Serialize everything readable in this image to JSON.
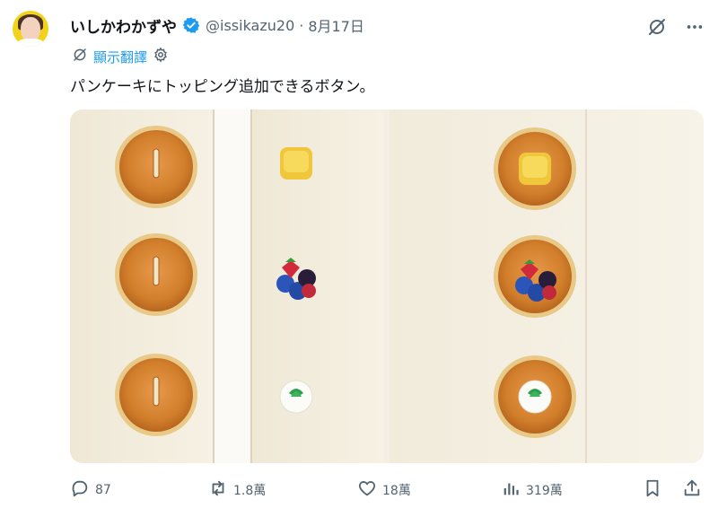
{
  "tweet": {
    "author_name": "いしかわかずや",
    "handle": "@issikazu20",
    "separator": "·",
    "date": "8月17日",
    "translate_label": "顯示翻譯",
    "text": "パンケーキにトッピング追加できるボタン。"
  },
  "actions": {
    "replies": "87",
    "retweets": "1.8萬",
    "likes": "18萬",
    "views": "319萬"
  },
  "colors": {
    "accent": "#1d9bf0",
    "secondary_text": "#536471",
    "avatar_bg": "#f2d21a"
  },
  "icons": [
    "verified-badge-icon",
    "grok-icon",
    "more-icon",
    "translate-globe-icon",
    "reply-icon",
    "retweet-icon",
    "like-icon",
    "views-icon",
    "bookmark-icon",
    "share-icon"
  ]
}
